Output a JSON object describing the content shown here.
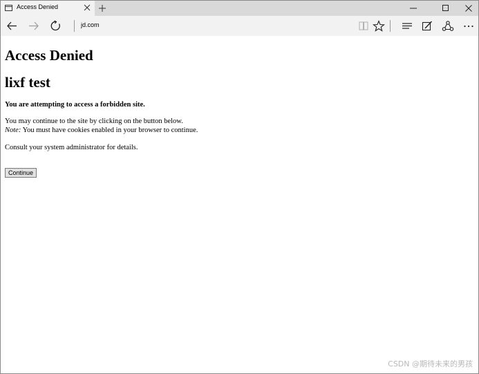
{
  "tab": {
    "title": "Access Denied"
  },
  "toolbar": {
    "address": "jd.com"
  },
  "icons": {
    "page": "page-icon",
    "close": "close-icon",
    "new_tab": "plus-icon",
    "minimize": "minimize-icon",
    "maximize": "maximize-icon",
    "window_close": "close-icon",
    "back": "back-arrow-icon",
    "forward": "forward-arrow-icon",
    "refresh": "refresh-icon",
    "reading_view": "book-icon",
    "favorite": "star-icon",
    "hub": "hub-icon",
    "web_note": "pen-icon",
    "share": "share-icon",
    "more": "more-icon"
  },
  "page": {
    "heading1": "Access Denied",
    "heading2": "lixf test",
    "warning": "You are attempting to access a forbidden site.",
    "line1": "You may continue to the site by clicking on the button below.",
    "note_label": "Note:",
    "note_text": " You must have cookies enabled in your browser to continue.",
    "consult": "Consult your system administrator for details.",
    "continue_label": "Continue"
  },
  "watermark": "CSDN @期待未来的男孩"
}
